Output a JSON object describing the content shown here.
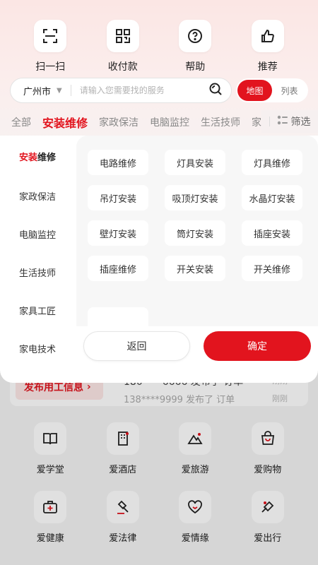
{
  "colors": {
    "accent": "#e2141e",
    "panel_bg": "#f7f7f7"
  },
  "quick_actions": [
    {
      "label": "扫一扫",
      "icon": "scan-icon"
    },
    {
      "label": "收付款",
      "icon": "qr-code-icon"
    },
    {
      "label": "帮助",
      "icon": "help-icon"
    },
    {
      "label": "推荐",
      "icon": "thumbs-up-icon"
    }
  ],
  "search": {
    "city": "广州市",
    "placeholder": "请输入您需要找的服务",
    "value": ""
  },
  "view_toggle": {
    "map": "地图",
    "list": "列表"
  },
  "tabs": [
    "全部",
    "安装维修",
    "家政保洁",
    "电脑监控",
    "生活技师",
    "家"
  ],
  "filter_label": "筛选",
  "categories": {
    "active_prefix": "安装",
    "active_suffix": "维修",
    "items": [
      "家政保洁",
      "电脑监控",
      "生活技师",
      "家具工匠",
      "家电技术"
    ]
  },
  "options": [
    "电路维修",
    "灯具安装",
    "灯具维修",
    "吊灯安装",
    "吸顶灯安装",
    "水晶灯安装",
    "壁灯安装",
    "筒灯安装",
    "插座安装",
    "插座维修",
    "开关安装",
    "开关维修"
  ],
  "buttons": {
    "back": "返回",
    "confirm": "确定"
  },
  "background": {
    "post_label": "发布用工信息",
    "line1": "180****6666 发布了 订单",
    "line2": "138****9999 发布了 订单",
    "tag1": "刚刚",
    "tag2": "刚刚"
  },
  "love_grid": [
    {
      "label": "爱学堂",
      "icon": "book-icon"
    },
    {
      "label": "爱酒店",
      "icon": "hotel-icon"
    },
    {
      "label": "爱旅游",
      "icon": "mountain-icon"
    },
    {
      "label": "爱购物",
      "icon": "shopping-bag-icon"
    },
    {
      "label": "爱健康",
      "icon": "medical-kit-icon"
    },
    {
      "label": "爱法律",
      "icon": "gavel-icon"
    },
    {
      "label": "爱情缘",
      "icon": "heart-icon"
    },
    {
      "label": "爱出行",
      "icon": "travel-icon"
    }
  ]
}
